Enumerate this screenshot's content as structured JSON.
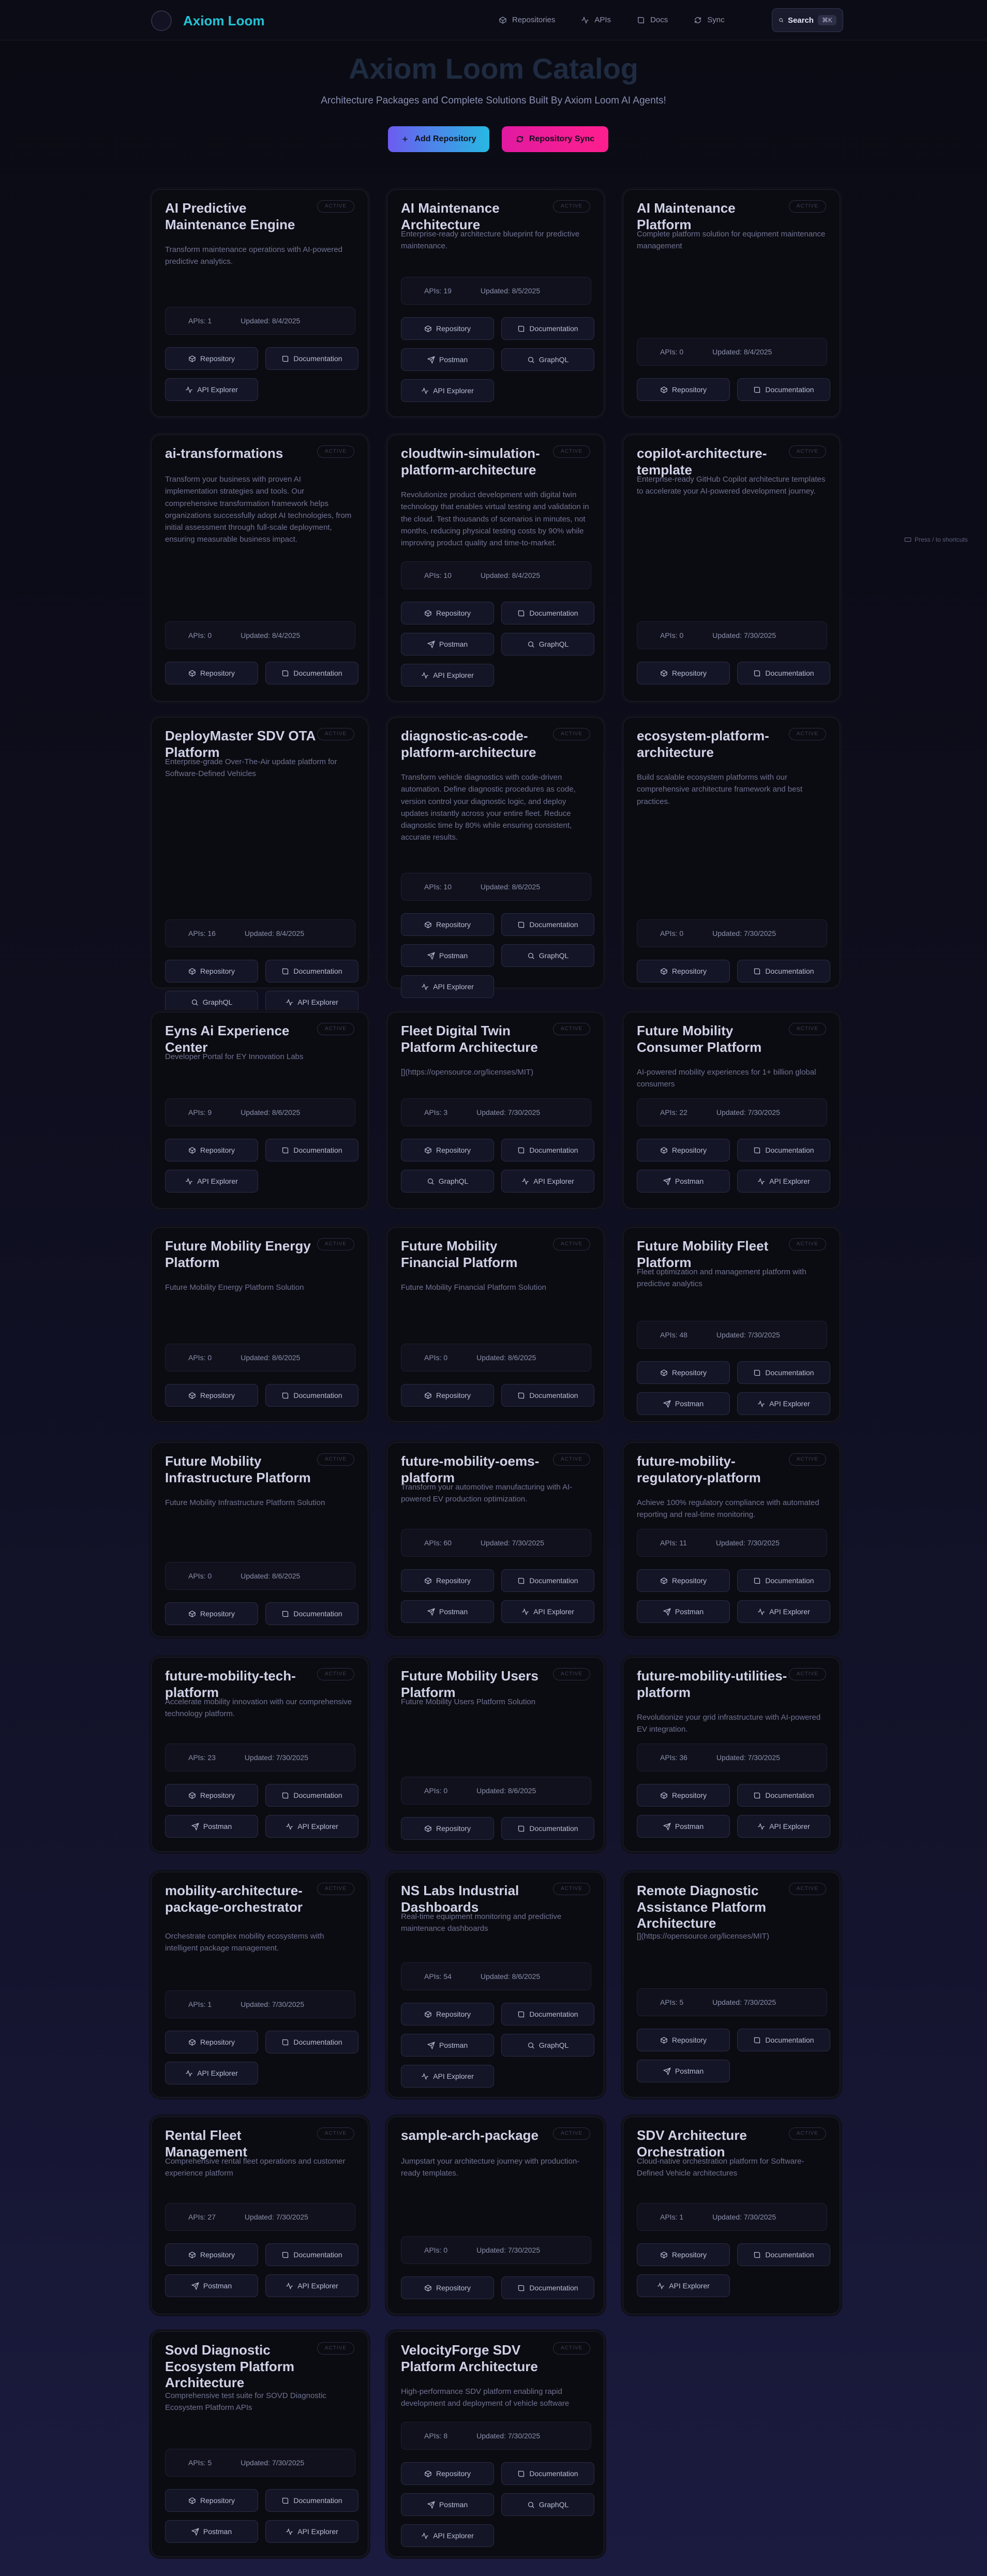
{
  "header": {
    "brand": "Axiom Loom",
    "nav": [
      "Repositories",
      "APIs",
      "Docs",
      "Sync"
    ],
    "search_label": "Search",
    "search_kbd": "⌘K"
  },
  "hero": {
    "title": "Axiom Loom Catalog",
    "subtitle": "Architecture Packages and Complete Solutions Built By Axiom Loom AI Agents!",
    "add_label": "Add Repository",
    "sync_label": "Repository Sync"
  },
  "floating_hint": "Press / to shortcuts",
  "badge_text": "ACTIVE",
  "cards": [
    {
      "title": "AI Predictive Maintenance Engine",
      "desc": "Transform maintenance operations with AI-powered predictive analytics.",
      "apis": "APIs: 1",
      "updated": "Updated: 8/4/2025",
      "buttons": [
        "Repository",
        "Documentation",
        "API Explorer"
      ]
    },
    {
      "title": "AI Maintenance Architecture",
      "desc": "Enterprise-ready architecture blueprint for predictive maintenance.",
      "apis": "APIs: 19",
      "updated": "Updated: 8/5/2025",
      "buttons": [
        "Repository",
        "Documentation",
        "Postman",
        "GraphQL",
        "API Explorer"
      ]
    },
    {
      "title": "AI Maintenance Platform",
      "desc": "Complete platform solution for equipment maintenance management",
      "apis": "APIs: 0",
      "updated": "Updated: 8/4/2025",
      "buttons": [
        "Repository",
        "Documentation"
      ]
    },
    {
      "title": "ai-transformations",
      "desc": "Transform your business with proven AI implementation strategies and tools. Our comprehensive transformation framework helps organizations successfully adopt AI technologies, from initial assessment through full-scale deployment, ensuring measurable business impact.",
      "apis": "APIs: 0",
      "updated": "Updated: 8/4/2025",
      "buttons": [
        "Repository",
        "Documentation"
      ]
    },
    {
      "title": "cloudtwin-simulation-platform-architecture",
      "desc": "Revolutionize product development with digital twin technology that enables virtual testing and validation in the cloud. Test thousands of scenarios in minutes, not months, reducing physical testing costs by 90% while improving product quality and time-to-market.",
      "apis": "APIs: 10",
      "updated": "Updated: 8/4/2025",
      "buttons": [
        "Repository",
        "Documentation",
        "Postman",
        "GraphQL",
        "API Explorer"
      ]
    },
    {
      "title": "copilot-architecture-template",
      "desc": "Enterprise-ready GitHub Copilot architecture templates to accelerate your AI-powered development journey.",
      "apis": "APIs: 0",
      "updated": "Updated: 7/30/2025",
      "buttons": [
        "Repository",
        "Documentation"
      ]
    },
    {
      "title": "DeployMaster SDV OTA Platform",
      "desc": "Enterprise-grade Over-The-Air update platform for Software-Defined Vehicles",
      "apis": "APIs: 16",
      "updated": "Updated: 8/4/2025",
      "buttons": [
        "Repository",
        "Documentation",
        "GraphQL",
        "API Explorer"
      ]
    },
    {
      "title": "diagnostic-as-code-platform-architecture",
      "desc": "Transform vehicle diagnostics with code-driven automation. Define diagnostic procedures as code, version control your diagnostic logic, and deploy updates instantly across your entire fleet. Reduce diagnostic time by 80% while ensuring consistent, accurate results.",
      "apis": "APIs: 10",
      "updated": "Updated: 8/6/2025",
      "buttons": [
        "Repository",
        "Documentation",
        "Postman",
        "GraphQL",
        "API Explorer"
      ]
    },
    {
      "title": "ecosystem-platform-architecture",
      "desc": "Build scalable ecosystem platforms with our comprehensive architecture framework and best practices.",
      "apis": "APIs: 0",
      "updated": "Updated: 7/30/2025",
      "buttons": [
        "Repository",
        "Documentation"
      ]
    },
    {
      "title": "Eyns Ai Experience Center",
      "desc": "Developer Portal for EY Innovation Labs",
      "apis": "APIs: 9",
      "updated": "Updated: 8/6/2025",
      "buttons": [
        "Repository",
        "Documentation",
        "API Explorer"
      ]
    },
    {
      "title": "Fleet Digital Twin Platform Architecture",
      "desc": "[](https://opensource.org/licenses/MIT)",
      "apis": "APIs: 3",
      "updated": "Updated: 7/30/2025",
      "buttons": [
        "Repository",
        "Documentation",
        "GraphQL",
        "API Explorer"
      ]
    },
    {
      "title": "Future Mobility Consumer Platform",
      "desc": "AI-powered mobility experiences for 1+ billion global consumers",
      "apis": "APIs: 22",
      "updated": "Updated: 7/30/2025",
      "buttons": [
        "Repository",
        "Documentation",
        "Postman",
        "API Explorer"
      ]
    },
    {
      "title": "Future Mobility Energy Platform",
      "desc": "Future Mobility Energy Platform Solution",
      "apis": "APIs: 0",
      "updated": "Updated: 8/6/2025",
      "buttons": [
        "Repository",
        "Documentation"
      ]
    },
    {
      "title": "Future Mobility Financial Platform",
      "desc": "Future Mobility Financial Platform Solution",
      "apis": "APIs: 0",
      "updated": "Updated: 8/6/2025",
      "buttons": [
        "Repository",
        "Documentation"
      ]
    },
    {
      "title": "Future Mobility Fleet Platform",
      "desc": "Fleet optimization and management platform with predictive analytics",
      "apis": "APIs: 48",
      "updated": "Updated: 7/30/2025",
      "buttons": [
        "Repository",
        "Documentation",
        "Postman",
        "API Explorer"
      ]
    },
    {
      "title": "Future Mobility Infrastructure Platform",
      "desc": "Future Mobility Infrastructure Platform Solution",
      "apis": "APIs: 0",
      "updated": "Updated: 8/6/2025",
      "buttons": [
        "Repository",
        "Documentation"
      ]
    },
    {
      "title": "future-mobility-oems-platform",
      "desc": "Transform your automotive manufacturing with AI-powered EV production optimization.",
      "apis": "APIs: 60",
      "updated": "Updated: 7/30/2025",
      "buttons": [
        "Repository",
        "Documentation",
        "Postman",
        "API Explorer"
      ]
    },
    {
      "title": "future-mobility-regulatory-platform",
      "desc": "Achieve 100% regulatory compliance with automated reporting and real-time monitoring.",
      "apis": "APIs: 11",
      "updated": "Updated: 7/30/2025",
      "buttons": [
        "Repository",
        "Documentation",
        "Postman",
        "API Explorer"
      ]
    },
    {
      "title": "future-mobility-tech-platform",
      "desc": "Accelerate mobility innovation with our comprehensive technology platform.",
      "apis": "APIs: 23",
      "updated": "Updated: 7/30/2025",
      "buttons": [
        "Repository",
        "Documentation",
        "Postman",
        "API Explorer"
      ]
    },
    {
      "title": "Future Mobility Users Platform",
      "desc": "Future Mobility Users Platform Solution",
      "apis": "APIs: 0",
      "updated": "Updated: 8/6/2025",
      "buttons": [
        "Repository",
        "Documentation"
      ]
    },
    {
      "title": "future-mobility-utilities-platform",
      "desc": "Revolutionize your grid infrastructure with AI-powered EV integration.",
      "apis": "APIs: 36",
      "updated": "Updated: 7/30/2025",
      "buttons": [
        "Repository",
        "Documentation",
        "Postman",
        "API Explorer"
      ]
    },
    {
      "title": "mobility-architecture-package-orchestrator",
      "desc": "Orchestrate complex mobility ecosystems with intelligent package management.",
      "apis": "APIs: 1",
      "updated": "Updated: 7/30/2025",
      "buttons": [
        "Repository",
        "Documentation",
        "API Explorer"
      ]
    },
    {
      "title": "NS Labs Industrial Dashboards",
      "desc": "Real-time equipment monitoring and predictive maintenance dashboards",
      "apis": "APIs: 54",
      "updated": "Updated: 8/6/2025",
      "buttons": [
        "Repository",
        "Documentation",
        "Postman",
        "GraphQL",
        "API Explorer"
      ]
    },
    {
      "title": "Remote Diagnostic Assistance Platform Architecture",
      "desc": "[](https://opensource.org/licenses/MIT)",
      "apis": "APIs: 5",
      "updated": "Updated: 7/30/2025",
      "buttons": [
        "Repository",
        "Documentation",
        "Postman"
      ]
    },
    {
      "title": "Rental Fleet Management",
      "desc": "Comprehensive rental fleet operations and customer experience platform",
      "apis": "APIs: 27",
      "updated": "Updated: 7/30/2025",
      "buttons": [
        "Repository",
        "Documentation",
        "Postman",
        "API Explorer"
      ]
    },
    {
      "title": "sample-arch-package",
      "desc": "Jumpstart your architecture journey with production-ready templates.",
      "apis": "APIs: 0",
      "updated": "Updated: 7/30/2025",
      "buttons": [
        "Repository",
        "Documentation"
      ]
    },
    {
      "title": "SDV Architecture Orchestration",
      "desc": "Cloud-native orchestration platform for Software-Defined Vehicle architectures",
      "apis": "APIs: 1",
      "updated": "Updated: 7/30/2025",
      "buttons": [
        "Repository",
        "Documentation",
        "API Explorer"
      ]
    },
    {
      "title": "Sovd Diagnostic Ecosystem Platform Architecture",
      "desc": "Comprehensive test suite for SOVD Diagnostic Ecosystem Platform APIs",
      "apis": "APIs: 5",
      "updated": "Updated: 7/30/2025",
      "buttons": [
        "Repository",
        "Documentation",
        "Postman",
        "API Explorer"
      ]
    },
    {
      "title": "VelocityForge SDV Platform Architecture",
      "desc": "High-performance SDV platform enabling rapid development and deployment of vehicle software",
      "apis": "APIs: 8",
      "updated": "Updated: 7/30/2025",
      "buttons": [
        "Repository",
        "Documentation",
        "Postman",
        "GraphQL",
        "API Explorer"
      ]
    }
  ]
}
